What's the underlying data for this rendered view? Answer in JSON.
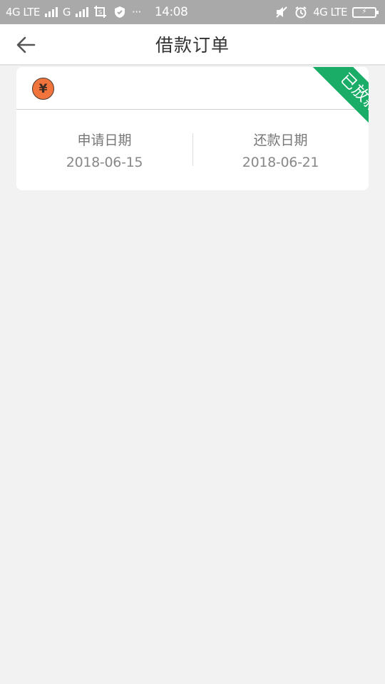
{
  "status_bar": {
    "network_1": "4G LTE",
    "network_2": "G",
    "time": "14:08",
    "network_3": "4G LTE",
    "more": "···",
    "icons": [
      "signal-icon",
      "screenshot-icon",
      "shield-icon",
      "mute-icon",
      "alarm-icon",
      "battery-charging-icon"
    ]
  },
  "nav": {
    "title": "借款订单",
    "back_icon": "arrow-left-icon"
  },
  "order": {
    "currency_symbol": "¥",
    "status": "已放款",
    "apply_date_label": "申请日期",
    "apply_date": "2018-06-15",
    "repay_date_label": "还款日期",
    "repay_date": "2018-06-21"
  },
  "colors": {
    "status_bar_bg": "#a9a9a9",
    "page_bg": "#f2f2f2",
    "ribbon": "#1aad67",
    "coin": "#f0743b"
  }
}
